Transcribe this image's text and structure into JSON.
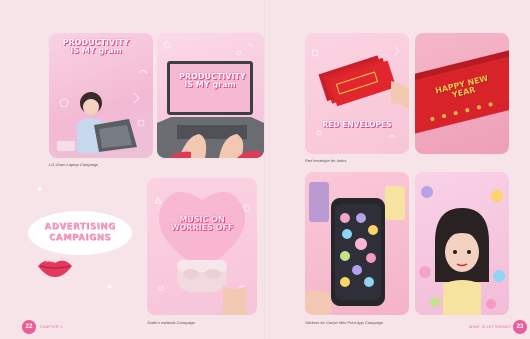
{
  "left_page": {
    "photo1": {
      "lettering": "PRODUCTIVITY IS MY gram"
    },
    "photo2": {
      "lettering": "PRODUCTIVITY IS MY gram"
    },
    "caption_lg": "LG Gram Laptop Campaign",
    "ad_title_line1": "ADVERTISING",
    "ad_title_line2": "CAMPAIGNS",
    "photo5": {
      "lettering": "MUSIC ON WORRIES OFF"
    },
    "caption_sudio": "Sudio's earbuds Campaign",
    "page_number": "22",
    "footer": "CHAPTER 1"
  },
  "right_page": {
    "photo3": {
      "lettering": "RED ENVELOPES"
    },
    "photo4": {
      "lettering": "HAPPY NEW YEAR"
    },
    "caption_red": "Red envelope for Indos",
    "caption_canon": "Stickers for Canon Mini Print App Campaign",
    "page_number": "23",
    "footer": "WHAT IS LETTERING?"
  },
  "colors": {
    "background": "#f7e4e9",
    "accent": "#e95f9a",
    "lettering_pink": "#f2a0c4",
    "envelope_red": "#d8232a"
  }
}
